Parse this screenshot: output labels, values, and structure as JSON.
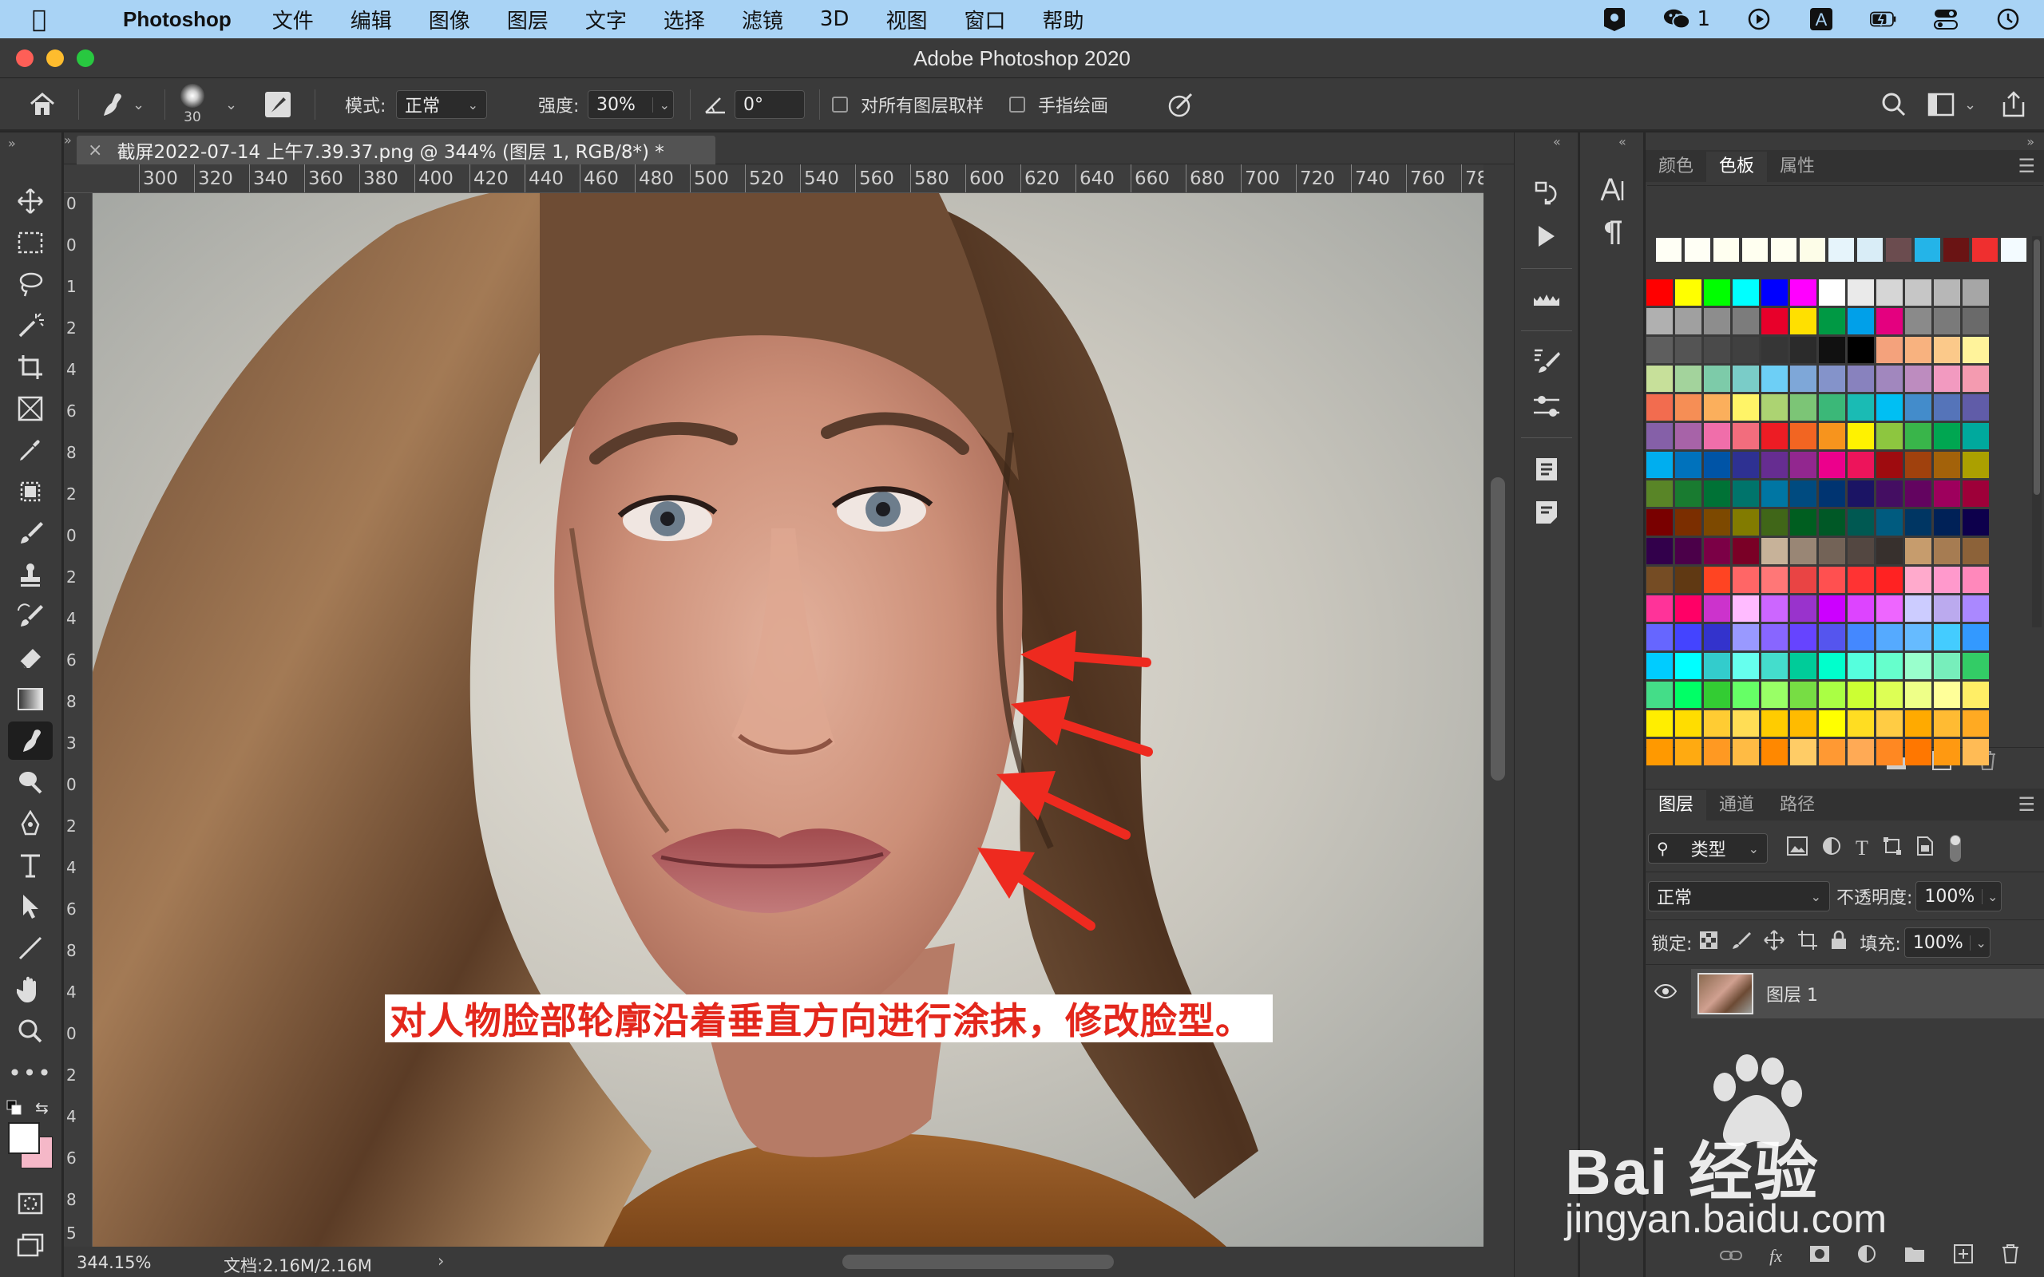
{
  "menubar": {
    "app_name": "Photoshop",
    "items": [
      "文件",
      "编辑",
      "图像",
      "图层",
      "文字",
      "选择",
      "滤镜",
      "3D",
      "视图",
      "窗口",
      "帮助"
    ],
    "wechat_badge": "1"
  },
  "window": {
    "title": "Adobe Photoshop 2020"
  },
  "options": {
    "brush_size": "30",
    "mode_label": "模式:",
    "mode_value": "正常",
    "strength_label": "强度:",
    "strength_value": "30%",
    "angle_value": "0°",
    "sample_all_layers": "对所有图层取样",
    "finger_painting": "手指绘画"
  },
  "document": {
    "tab_title": "截屏2022-07-14 上午7.39.37.png @ 344% (图层 1, RGB/8*) *",
    "ruler_ticks": [
      "300",
      "320",
      "340",
      "360",
      "380",
      "400",
      "420",
      "440",
      "460",
      "480",
      "500",
      "520",
      "540",
      "560",
      "580",
      "600",
      "620",
      "640",
      "660",
      "680",
      "700",
      "720",
      "740",
      "760",
      "78"
    ],
    "zoom": "344.15%",
    "doc_size": "文档:2.16M/2.16M",
    "caption": "对人物脸部轮廓沿着垂直方向进行涂抹，修改脸型。"
  },
  "swatch_panel": {
    "tabs": [
      "颜色",
      "色板",
      "属性"
    ],
    "active_tab": "色板",
    "recent": [
      "#fffff5",
      "#fffff5",
      "#fffff0",
      "#fffff0",
      "#fffff0",
      "#fdfde8",
      "#e6f4fb",
      "#d9edf7",
      "#6b4c4f",
      "#24b4e8",
      "#6a1414",
      "#ef2f2f",
      "#f3fbff"
    ],
    "rows": [
      [
        "#ff0000",
        "#ffff00",
        "#00ff00",
        "#00ffff",
        "#0000ff",
        "#ff00ff",
        "#ffffff",
        "#eaeaea",
        "#d6d6d6",
        "#c6c6c6",
        "#b7b7b7",
        "#a6a6a6"
      ],
      [
        "#b0b0b0",
        "#a0a0a0",
        "#8d8d8d",
        "#7c7c7c",
        "#e8002a",
        "#ffe000",
        "#009944",
        "#00a0e9",
        "#e4007f",
        "#8a8a8a",
        "#7a7a7a",
        "#6a6a6a"
      ],
      [
        "#5e5e5e",
        "#545454",
        "#4a4a4a",
        "#404040",
        "#363636",
        "#2b2b2b",
        "#111111",
        "#000000",
        "#f4a27c",
        "#f8b27f",
        "#fbc98a",
        "#fff39b"
      ],
      [
        "#c7e09a",
        "#a3d39c",
        "#7dcba9",
        "#7accc8",
        "#6dcff6",
        "#7ea7d8",
        "#8493ca",
        "#8882be",
        "#a187be",
        "#bd8cbf",
        "#f29ac0",
        "#f49bb0"
      ],
      [
        "#f26c4f",
        "#f68e55",
        "#fbaf5c",
        "#fff467",
        "#acd372",
        "#7cc576",
        "#3bb878",
        "#1abbb4",
        "#00bff3",
        "#438ccb",
        "#5574b9",
        "#605ca8"
      ],
      [
        "#8560a8",
        "#a763a8",
        "#f06eaa",
        "#f26d7d",
        "#ed1c24",
        "#f26522",
        "#f7941d",
        "#fff200",
        "#8dc63f",
        "#39b54a",
        "#00a651",
        "#00a99d"
      ],
      [
        "#00aeef",
        "#0072bc",
        "#0054a6",
        "#2e3192",
        "#662d91",
        "#92278f",
        "#ec008c",
        "#ed145b",
        "#9e0b0f",
        "#a0410d",
        "#a3620a",
        "#aba000"
      ],
      [
        "#598527",
        "#197b30",
        "#007236",
        "#00746b",
        "#0076a3",
        "#004b80",
        "#003471",
        "#1b1464",
        "#440e62",
        "#630460",
        "#9e005d",
        "#9e0039"
      ],
      [
        "#790000",
        "#7b2e00",
        "#7d4900",
        "#827b00",
        "#406618",
        "#005e20",
        "#005826",
        "#005952",
        "#005b7f",
        "#003663",
        "#002157",
        "#0d004c"
      ],
      [
        "#32004b",
        "#4b0049",
        "#7b0046",
        "#7a0026",
        "#c7b299",
        "#998675",
        "#736357",
        "#534741",
        "#37302d",
        "#c69c6d",
        "#a67c52",
        "#8c6239"
      ],
      [
        "#754c24",
        "#603913",
        "#ff4422",
        "#ff6666",
        "#ff7777",
        "#e94444",
        "#ff5050",
        "#ff3333",
        "#ff2222",
        "#ffaacc",
        "#ff99cc",
        "#ff88bb"
      ],
      [
        "#ff3399",
        "#ff0066",
        "#cc33cc",
        "#ffbbff",
        "#cc66ff",
        "#9933cc",
        "#cc00ff",
        "#dd44ff",
        "#ee66ff",
        "#ccccff",
        "#bbaaee",
        "#aa88ff"
      ],
      [
        "#6666ff",
        "#4444ff",
        "#3333cc",
        "#9999ff",
        "#8866ff",
        "#6644ff",
        "#5555ee",
        "#4488ff",
        "#55aaff",
        "#66bbff",
        "#44ccff",
        "#3399ff"
      ],
      [
        "#00ccff",
        "#00ffff",
        "#33cccc",
        "#66ffee",
        "#44ddcc",
        "#00cc99",
        "#00ffcc",
        "#55ffdd",
        "#66ffcc",
        "#99ffcc",
        "#77eebb",
        "#33cc66"
      ],
      [
        "#44dd88",
        "#00ff66",
        "#33cc33",
        "#66ff66",
        "#99ff66",
        "#77dd44",
        "#aaff44",
        "#ccff33",
        "#ddff55",
        "#eeff88",
        "#ffff99",
        "#ffee66"
      ],
      [
        "#ffee00",
        "#ffdd00",
        "#ffcc33",
        "#ffdd55",
        "#ffcc00",
        "#ffbb00",
        "#ffff00",
        "#ffdd22",
        "#ffcc44",
        "#ffaa00",
        "#ffbb33",
        "#ffaa22"
      ],
      [
        "#ff9900",
        "#ffaa11",
        "#ff9922",
        "#ffbb44",
        "#ff8800",
        "#ffcc66",
        "#ff9933",
        "#ffaa55",
        "#ff8822",
        "#ff7700",
        "#ff9911",
        "#ffbb55"
      ]
    ]
  },
  "layers_panel": {
    "tabs": [
      "图层",
      "通道",
      "路径"
    ],
    "filter_label": "类型",
    "blend_mode": "正常",
    "opacity_label": "不透明度:",
    "opacity_value": "100%",
    "lock_label": "锁定:",
    "fill_label": "填充:",
    "fill_value": "100%",
    "layer_name": "图层 1"
  },
  "watermark": {
    "brand": "Bai 经验",
    "url": "jingyan.baidu.com"
  },
  "colors": {
    "menubar_bg": "#a9d3f5",
    "panel_bg": "#3a3a3a",
    "caption_text": "#e3271c",
    "arrow": "#ee2a1f",
    "foreground": "#ffffff",
    "background": "#f5b8c8"
  }
}
